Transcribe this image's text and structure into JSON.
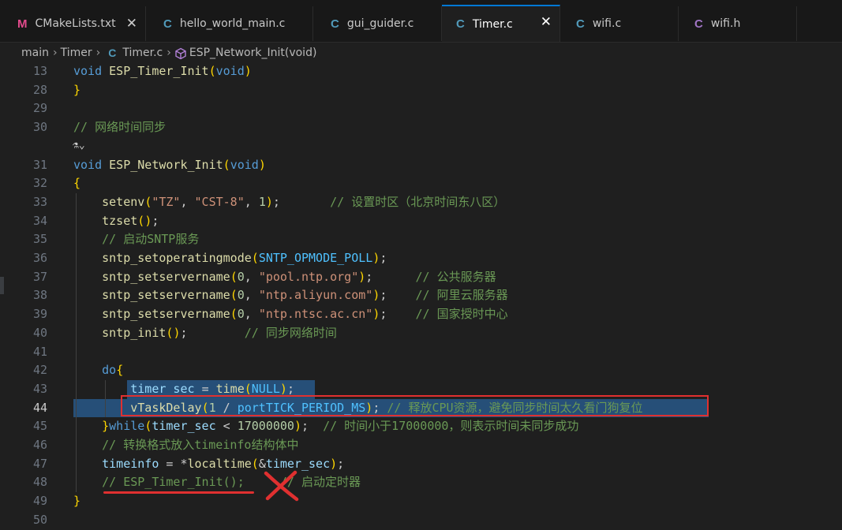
{
  "tabs": [
    {
      "icon": "M",
      "label": "CMakeLists.txt",
      "close": "✕"
    },
    {
      "icon": "C",
      "label": "hello_world_main.c"
    },
    {
      "icon": "C",
      "label": "gui_guider.c"
    },
    {
      "icon": "C",
      "label": "Timer.c",
      "close": "✕"
    },
    {
      "icon": "C",
      "label": "wifi.c"
    },
    {
      "icon": "C",
      "label": "wifi.h"
    }
  ],
  "breadcrumb": {
    "folder1": "main",
    "folder2": "Timer",
    "file_icon": "C",
    "file": "Timer.c",
    "symbol": "ESP_Network_Init(void)"
  },
  "editor": {
    "active_line": "44",
    "lines": [
      {
        "num": "13",
        "text": "void ESP_Timer_Init(void)"
      },
      {
        "num": "28",
        "text": "}"
      },
      {
        "num": "29",
        "text": ""
      },
      {
        "num": "30",
        "text": "// 网络时间同步"
      },
      {
        "num": "",
        "text": "⚗⌄"
      },
      {
        "num": "31",
        "text": "void ESP_Network_Init(void)"
      },
      {
        "num": "32",
        "text": "{"
      },
      {
        "num": "33",
        "text": "    setenv(\"TZ\", \"CST-8\", 1);       // 设置时区（北京时间东八区）"
      },
      {
        "num": "34",
        "text": "    tzset();"
      },
      {
        "num": "35",
        "text": "    // 启动SNTP服务"
      },
      {
        "num": "36",
        "text": "    sntp_setoperatingmode(SNTP_OPMODE_POLL);"
      },
      {
        "num": "37",
        "text": "    sntp_setservername(0, \"pool.ntp.org\");      // 公共服务器"
      },
      {
        "num": "38",
        "text": "    sntp_setservername(0, \"ntp.aliyun.com\");    // 阿里云服务器"
      },
      {
        "num": "39",
        "text": "    sntp_setservername(0, \"ntp.ntsc.ac.cn\");    // 国家授时中心"
      },
      {
        "num": "40",
        "text": "    sntp_init();        // 同步网络时间"
      },
      {
        "num": "41",
        "text": ""
      },
      {
        "num": "42",
        "text": "    do{"
      },
      {
        "num": "43",
        "text": "        timer_sec = time(NULL);"
      },
      {
        "num": "44",
        "text": "        vTaskDelay(1 / portTICK_PERIOD_MS); // 释放CPU资源，避免同步时间太久看门狗复位"
      },
      {
        "num": "45",
        "text": "    }while(timer_sec < 17000000);  // 时间小于17000000，则表示时间未同步成功"
      },
      {
        "num": "46",
        "text": "    // 转换格式放入timeinfo结构体中"
      },
      {
        "num": "47",
        "text": "    timeinfo = *localtime(&timer_sec);"
      },
      {
        "num": "48",
        "text": "    // ESP_Timer_Init();     // 启动定时器"
      },
      {
        "num": "49",
        "text": "}"
      },
      {
        "num": "50",
        "text": ""
      }
    ]
  },
  "annotation": {
    "mark": "✕"
  },
  "colors": {
    "background": "#1f1f1f",
    "keyword": "#569cd6",
    "function": "#dcdcaa",
    "string": "#ce9178",
    "number": "#b5cea8",
    "comment": "#6a9955",
    "macro": "#4fc1ff",
    "annotation_red": "#e03030",
    "cmake_icon": "#e44b8d",
    "c_icon": "#519aba",
    "h_icon": "#a074c4"
  }
}
